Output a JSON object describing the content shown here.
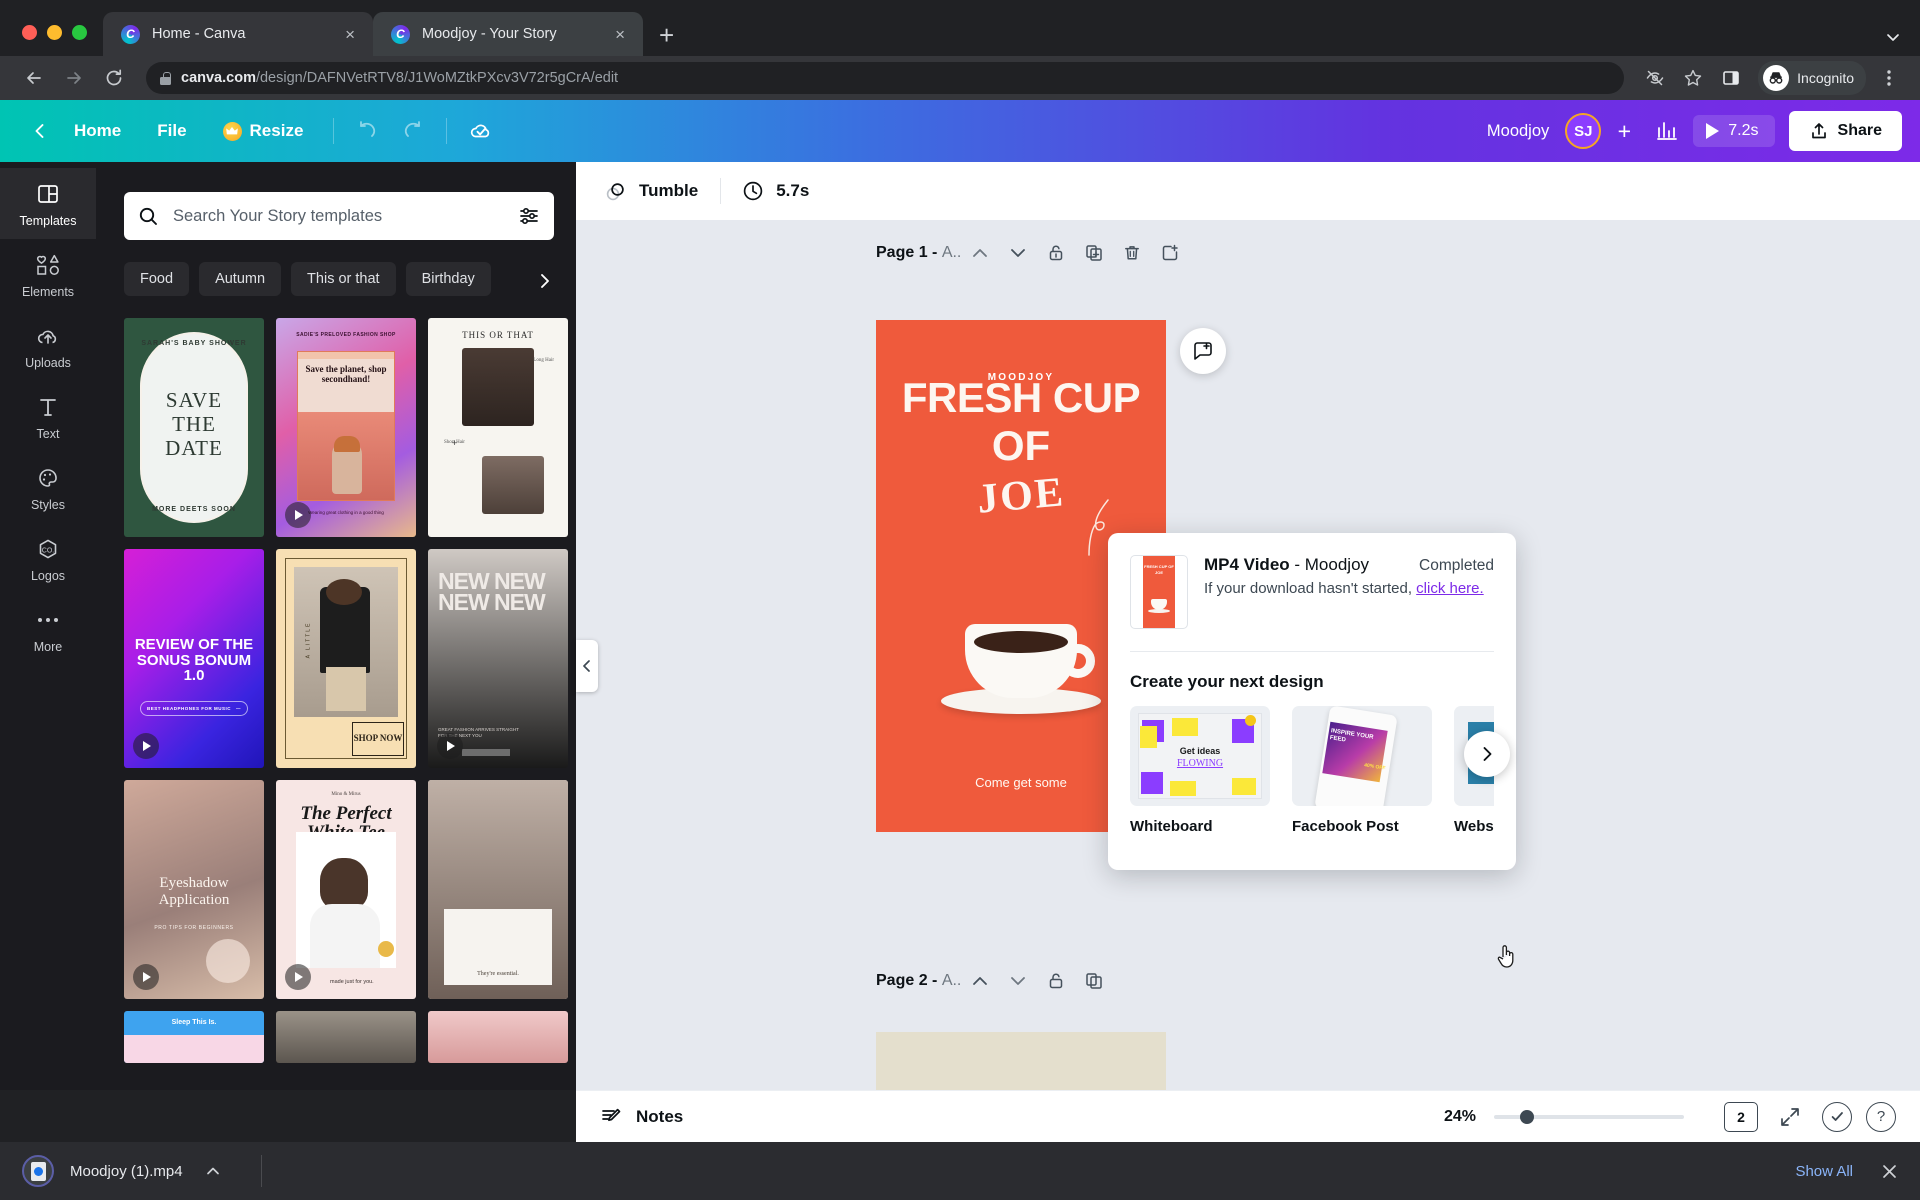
{
  "browser": {
    "tabs": [
      {
        "title": "Home - Canva",
        "active": false,
        "favicon": "canva-icon",
        "close": "×"
      },
      {
        "title": "Moodjoy - Your Story",
        "active": true,
        "favicon": "canva-icon",
        "close": "×"
      }
    ],
    "new_tab_label": "+",
    "tabstrip_chevron": "⌄",
    "nav": {
      "back": "←",
      "forward": "→",
      "reload": "⟳"
    },
    "omnibox": {
      "host": "canva.com",
      "path": "/design/DAFNVetRTV8/J1WoMZtkPXcv3V72r5gCrA/edit",
      "lock_icon": "lock-icon"
    },
    "toolbar_icons": [
      "eye-off-icon",
      "star-icon",
      "side-panel-icon"
    ],
    "profile": {
      "label": "Incognito",
      "icon": "incognito-icon"
    },
    "menu_icon": "kebab-menu-icon"
  },
  "canva_header": {
    "back_icon": "chevron-left-icon",
    "home_label": "Home",
    "file_label": "File",
    "resize_label": "Resize",
    "resize_badge": "crown-icon",
    "undo_icon": "undo-icon",
    "redo_icon": "redo-icon",
    "cloud_saved_icon": "cloud-check-icon",
    "design_name": "Moodjoy",
    "avatar_initials": "SJ",
    "add_people_label": "+",
    "analytics_icon": "bar-chart-icon",
    "present_duration": "7.2s",
    "share_label": "Share",
    "share_icon": "share-upload-icon"
  },
  "rail": {
    "items": [
      {
        "label": "Templates",
        "icon": "templates-icon",
        "active": true
      },
      {
        "label": "Elements",
        "icon": "elements-icon",
        "active": false
      },
      {
        "label": "Uploads",
        "icon": "upload-cloud-icon",
        "active": false
      },
      {
        "label": "Text",
        "icon": "text-icon",
        "active": false
      },
      {
        "label": "Styles",
        "icon": "palette-icon",
        "active": false
      },
      {
        "label": "Logos",
        "icon": "logos-icon",
        "active": false
      },
      {
        "label": "More",
        "icon": "more-dots-icon",
        "active": false
      }
    ]
  },
  "panel": {
    "search": {
      "placeholder": "Search Your Story templates",
      "icon": "search-icon",
      "filter_icon": "filter-sliders-icon"
    },
    "chips": [
      "Food",
      "Autumn",
      "This or that",
      "Birthday"
    ],
    "chips_next_icon": "chevron-right-icon",
    "collapse_icon": "chevron-left-icon",
    "templates": [
      {
        "name": "Save The Date baby shower",
        "title": "SAVE\nTHE\nDATE",
        "top_text": "SARAH'S BABY SHOWER",
        "bottom_text": "MORE DEETS SOON",
        "video": false
      },
      {
        "name": "Save the planet shop secondhand",
        "title": "Save the planet, shop secondhand!",
        "top_text": "SADIE'S PRELOVED FASHION SHOP",
        "video": true
      },
      {
        "name": "This or that hair",
        "title": "THIS OR THAT",
        "video": false
      },
      {
        "name": "Review of the Sonus Bonum",
        "title": "REVIEW OF THE SONUS BONUM 1.0",
        "sub_text": "BEST HEADPHONES FOR MUSIC",
        "video": true
      },
      {
        "name": "Shop Now fashion",
        "title": "SHOP NOW",
        "side_text": "A LITTLE",
        "video": false
      },
      {
        "name": "New new new",
        "title": "NEW NEW NEW NEW",
        "video": true
      },
      {
        "name": "Eyeshadow Application",
        "title": "Eyeshadow Application",
        "sub_text": "PRO TIPS FOR BEGINNERS",
        "video": true
      },
      {
        "name": "The Perfect White Tee",
        "title": "The Perfect White Tee",
        "top_text": "Mino & Mirus",
        "sub_text": "made just for you.",
        "video": true
      },
      {
        "name": "Beauty essentials",
        "title": "They're essential.",
        "video": false
      },
      {
        "name": "Blue wave story",
        "title": "Sleep This Is.",
        "video": false
      },
      {
        "name": "Mountain story",
        "title": "",
        "video": false
      },
      {
        "name": "Pink portrait story",
        "title": "",
        "video": false
      }
    ]
  },
  "editor": {
    "context_toolbar": {
      "animation_label": "Tumble",
      "animation_icon": "animation-tumble-icon",
      "duration_label": "5.7s",
      "duration_icon": "clock-icon"
    },
    "page1": {
      "label": "Page 1 - ",
      "label_dim": "A..",
      "icons": [
        "chevron-up-icon",
        "chevron-down-icon",
        "unlock-icon",
        "duplicate-page-icon",
        "delete-page-icon",
        "add-page-icon"
      ]
    },
    "page2": {
      "label": "Page 2 - ",
      "label_dim": "A..",
      "icons": [
        "chevron-up-icon",
        "chevron-down-icon",
        "unlock-icon",
        "duplicate-page-icon"
      ]
    },
    "add_comment_icon": "add-comment-icon",
    "design": {
      "brand": "MOODJOY",
      "line1": "FRESH CUP",
      "line2": "OF",
      "line3": "JOE",
      "cta": "Come get some",
      "bg_color": "#ef5a3c",
      "text_color": "#fdf6f0"
    }
  },
  "popover": {
    "file_type": "MP4 Video",
    "separator": " - ",
    "design_name": "Moodjoy",
    "status": "Completed",
    "sub_text": "If your download hasn't started, ",
    "link_text": "click here.",
    "section_title": "Create your next design",
    "thumb_title": "FRESH CUP OF JOE",
    "cards": [
      {
        "label": "Whiteboard",
        "preview_text_1": "Get ideas",
        "preview_text_2": "FLOWING"
      },
      {
        "label": "Facebook Post",
        "preview_text_1": "INSPIRE YOUR FEED",
        "preview_text_2": "40% OFF"
      },
      {
        "label": "Website",
        "preview_text_1": "",
        "preview_text_2": ""
      }
    ],
    "next_icon": "chevron-right-icon",
    "cursor": "hand-cursor-icon"
  },
  "statusbar": {
    "notes_label": "Notes",
    "notes_icon": "notes-pencil-icon",
    "zoom_level": "24%",
    "page_count": "2",
    "grid_icon": "grid-view-icon",
    "fullscreen_icon": "expand-icon",
    "check_icon": "check-circle-icon",
    "help_icon": "help-circle-icon"
  },
  "download_shelf": {
    "file_name": "Moodjoy (1).mp4",
    "file_icon": "video-file-icon",
    "expand_icon": "chevron-up-icon",
    "show_all_label": "Show All",
    "close_icon": "close-icon"
  }
}
